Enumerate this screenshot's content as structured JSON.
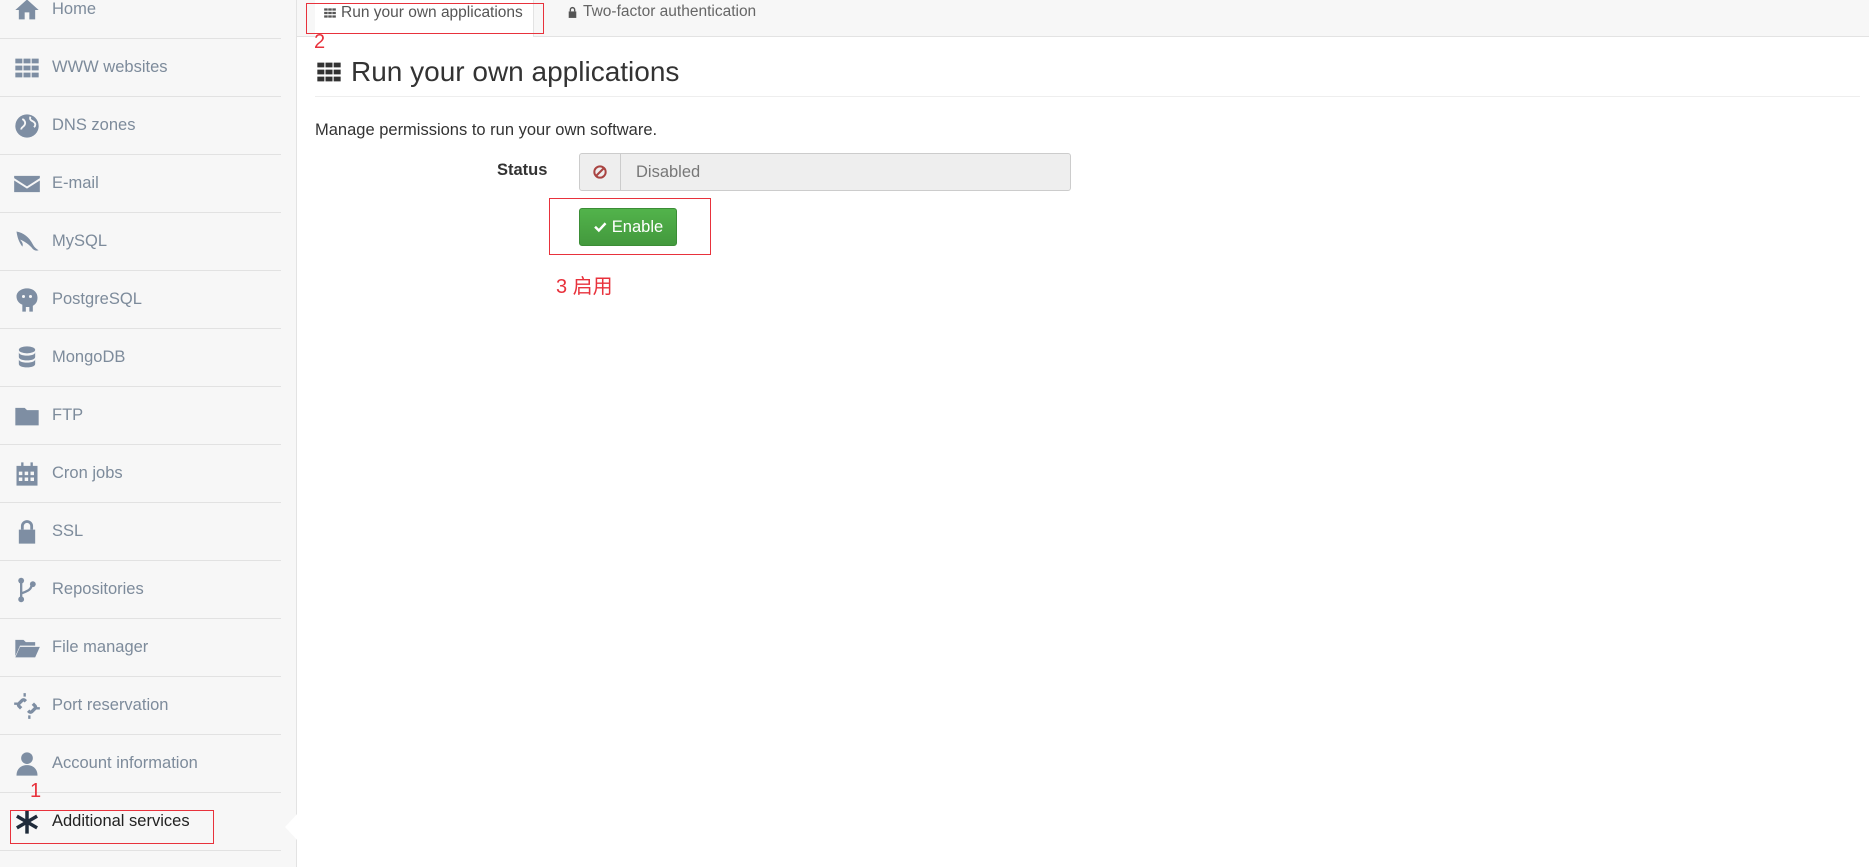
{
  "sidebar": {
    "items": [
      {
        "label": "Home",
        "icon": "home-icon"
      },
      {
        "label": "WWW websites",
        "icon": "grid-icon"
      },
      {
        "label": "DNS zones",
        "icon": "globe-icon"
      },
      {
        "label": "E-mail",
        "icon": "envelope-icon"
      },
      {
        "label": "MySQL",
        "icon": "dolphin-icon"
      },
      {
        "label": "PostgreSQL",
        "icon": "elephant-icon"
      },
      {
        "label": "MongoDB",
        "icon": "database-icon"
      },
      {
        "label": "FTP",
        "icon": "folder-icon"
      },
      {
        "label": "Cron jobs",
        "icon": "calendar-icon"
      },
      {
        "label": "SSL",
        "icon": "lock-icon"
      },
      {
        "label": "Repositories",
        "icon": "branch-icon"
      },
      {
        "label": "File manager",
        "icon": "folder-open-icon"
      },
      {
        "label": "Port reservation",
        "icon": "unlink-icon"
      },
      {
        "label": "Account information",
        "icon": "user-icon"
      },
      {
        "label": "Additional services",
        "icon": "asterisk-icon",
        "active": true
      }
    ]
  },
  "tabs": {
    "apps_label": "Run your own applications",
    "twofa_label": "Two-factor authentication"
  },
  "main": {
    "title": "Run your own applications",
    "description": "Manage permissions to run your own software.",
    "status_label": "Status",
    "status_value": "Disabled",
    "enable_label": "Enable"
  },
  "annotations": {
    "one": "1",
    "two": "2",
    "three": "3 启用"
  },
  "colors": {
    "accent_green": "#4aa544",
    "annotation_red": "#e8323c",
    "sidebar_icon": "#7e8ea3"
  }
}
